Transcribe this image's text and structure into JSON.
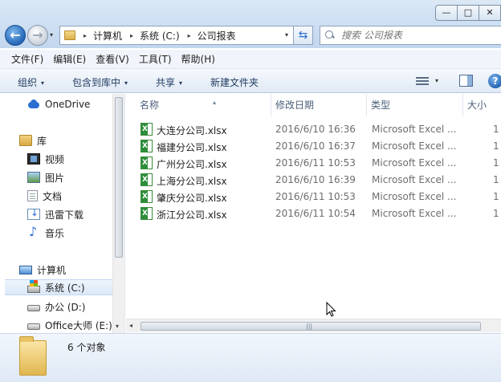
{
  "window": {
    "controls": {
      "minimize": "—",
      "maximize": "□",
      "close": "✕"
    }
  },
  "nav": {
    "back_glyph": "←",
    "forward_glyph": "→",
    "recent_glyph": "▾",
    "breadcrumb": [
      "计算机",
      "系统 (C:)",
      "公司报表"
    ],
    "crumb_separator": "▸",
    "address_dropdown": "▾",
    "refresh_glyph": "⇆",
    "search_placeholder": "搜索 公司报表"
  },
  "menubar": [
    "文件(F)",
    "编辑(E)",
    "查看(V)",
    "工具(T)",
    "帮助(H)"
  ],
  "commandbar": {
    "organize": "组织",
    "include_in_library": "包含到库中",
    "share": "共享",
    "new_folder": "新建文件夹",
    "dropdown": "▾",
    "help": "?"
  },
  "sidebar": {
    "items": [
      {
        "label": "OneDrive",
        "icon": "onedrive-icon"
      },
      {
        "label": "库",
        "icon": "library-icon"
      },
      {
        "label": "视频",
        "icon": "video-icon"
      },
      {
        "label": "图片",
        "icon": "picture-icon"
      },
      {
        "label": "文档",
        "icon": "document-icon"
      },
      {
        "label": "迅雷下载",
        "icon": "download-icon"
      },
      {
        "label": "音乐",
        "icon": "music-icon"
      },
      {
        "label": "计算机",
        "icon": "computer-icon"
      },
      {
        "label": "系统 (C:)",
        "icon": "system-drive-icon",
        "selected": true
      },
      {
        "label": "办公 (D:)",
        "icon": "drive-icon"
      },
      {
        "label": "Office大师 (E:)",
        "icon": "drive-icon"
      }
    ]
  },
  "table": {
    "columns": [
      "名称",
      "修改日期",
      "类型",
      "大小"
    ],
    "sort_indicator": "▴",
    "rows": [
      {
        "name": "大连分公司.xlsx",
        "date": "2016/6/10 16:36",
        "type": "Microsoft Excel ...",
        "size": "1"
      },
      {
        "name": "福建分公司.xlsx",
        "date": "2016/6/10 16:37",
        "type": "Microsoft Excel ...",
        "size": "1"
      },
      {
        "name": "广州分公司.xlsx",
        "date": "2016/6/11 10:53",
        "type": "Microsoft Excel ...",
        "size": "1"
      },
      {
        "name": "上海分公司.xlsx",
        "date": "2016/6/10 16:39",
        "type": "Microsoft Excel ...",
        "size": "1"
      },
      {
        "name": "肇庆分公司.xlsx",
        "date": "2016/6/11 10:53",
        "type": "Microsoft Excel ...",
        "size": "1"
      },
      {
        "name": "浙江分公司.xlsx",
        "date": "2016/6/11 10:54",
        "type": "Microsoft Excel ...",
        "size": "1"
      }
    ]
  },
  "scroll": {
    "left_arrow": "◂",
    "down_arrow": "▾",
    "grip": "|||"
  },
  "details": {
    "summary": "6 个对象"
  }
}
